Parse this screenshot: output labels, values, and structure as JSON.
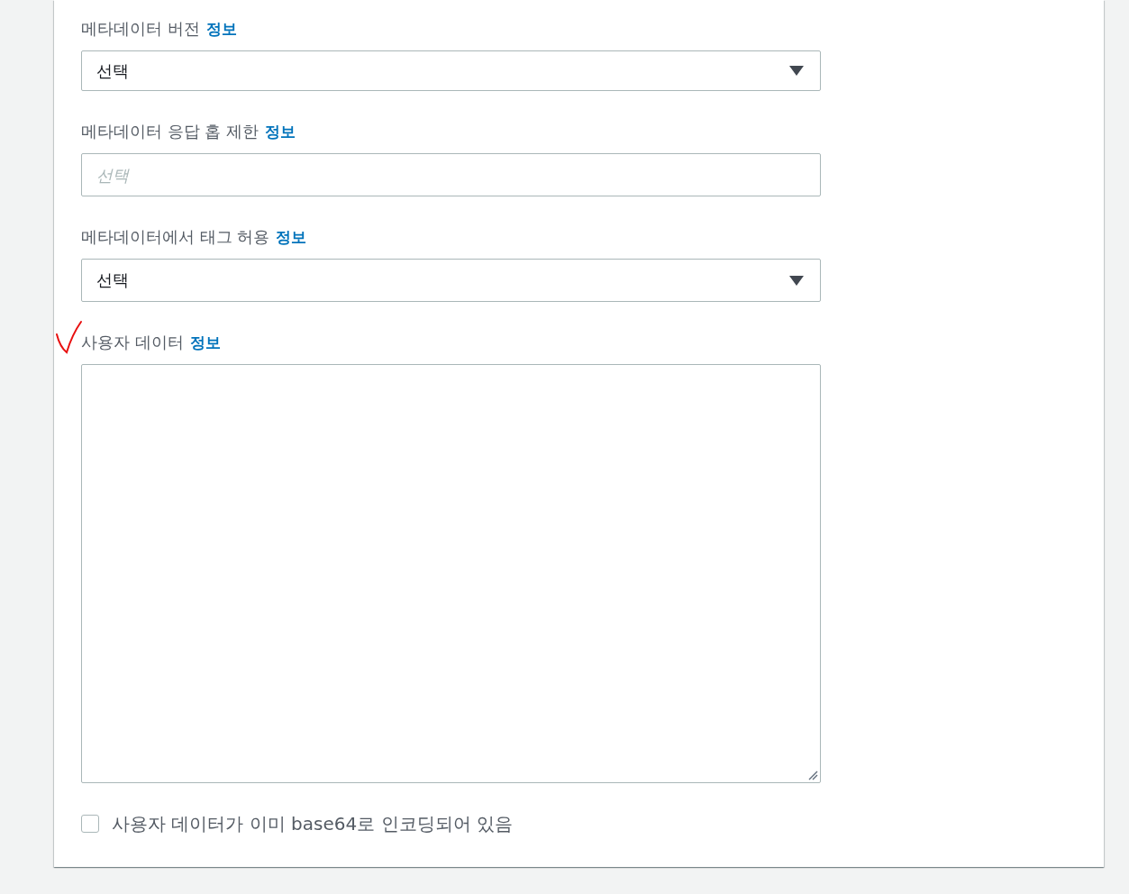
{
  "fields": [
    {
      "kind": "select",
      "label": "메타데이터 버전",
      "info_link": "정보",
      "value": "선택",
      "annotated": false
    },
    {
      "kind": "input",
      "label": "메타데이터 응답 홉 제한",
      "info_link": "정보",
      "placeholder": "선택",
      "annotated": false
    },
    {
      "kind": "select",
      "label": "메타데이터에서 태그 허용",
      "info_link": "정보",
      "value": "선택",
      "annotated": false
    },
    {
      "kind": "textarea",
      "label": "사용자 데이터",
      "info_link": "정보",
      "annotated": true
    }
  ],
  "checkbox": {
    "label": "사용자 데이터가 이미 base64로 인코딩되어 있음",
    "checked": false
  }
}
